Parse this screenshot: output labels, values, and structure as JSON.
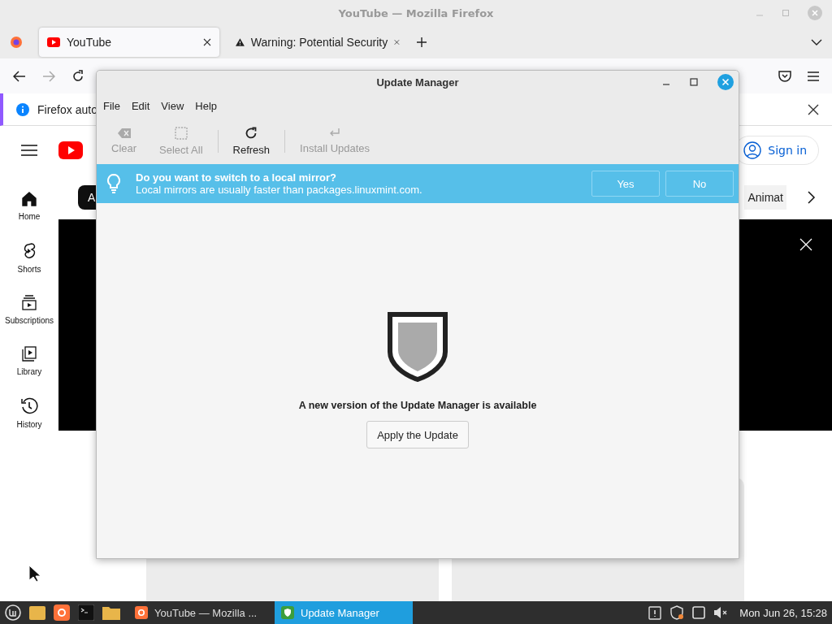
{
  "browser": {
    "title": "YouTube — Mozilla Firefox",
    "tabs": [
      {
        "label": "YouTube",
        "selected": true,
        "kind": "youtube"
      },
      {
        "label": "Warning: Potential Security",
        "selected": false,
        "kind": "warning"
      }
    ],
    "notification": "Firefox auto",
    "page": {
      "sign_in": "Sign in",
      "chips": [
        "A",
        "Animat"
      ],
      "sidebar": [
        {
          "label": "Home",
          "kind": "home"
        },
        {
          "label": "Shorts",
          "kind": "shorts"
        },
        {
          "label": "Subscriptions",
          "kind": "subscriptions"
        },
        {
          "label": "Library",
          "kind": "library"
        },
        {
          "label": "History",
          "kind": "history"
        }
      ]
    }
  },
  "dialog": {
    "title": "Update Manager",
    "menu": [
      "File",
      "Edit",
      "View",
      "Help"
    ],
    "toolbar": [
      {
        "label": "Clear",
        "kind": "clear",
        "disabled": true
      },
      {
        "label": "Select All",
        "kind": "select",
        "disabled": true
      },
      {
        "label": "Refresh",
        "kind": "refresh",
        "disabled": false
      },
      {
        "label": "Install Updates",
        "kind": "install",
        "disabled": true
      }
    ],
    "infobar": {
      "question": "Do you want to switch to a local mirror?",
      "detail": "Local mirrors are usually faster than packages.linuxmint.com.",
      "buttons": [
        "Yes",
        "No"
      ]
    },
    "message": "A new version of the Update Manager is available",
    "action": "Apply the Update"
  },
  "taskbar": {
    "tasks": [
      {
        "label": "YouTube — Mozilla ...",
        "kind": "firefox",
        "selected": false
      },
      {
        "label": "Update Manager",
        "kind": "update",
        "selected": true
      }
    ],
    "clock": "Mon Jun 26, 15:28"
  }
}
